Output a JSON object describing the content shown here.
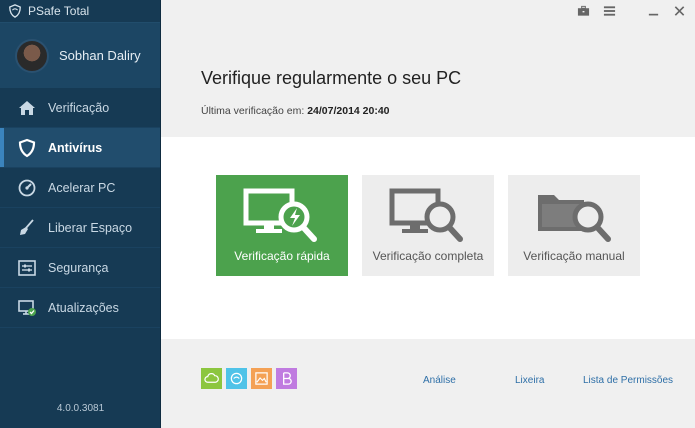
{
  "app": {
    "title": "PSafe Total",
    "version": "4.0.0.3081"
  },
  "user": {
    "name": "Sobhan Daliry"
  },
  "sidebar": {
    "items": [
      {
        "label": "Verificação",
        "icon": "home-icon"
      },
      {
        "label": "Antivírus",
        "icon": "shield-icon"
      },
      {
        "label": "Acelerar PC",
        "icon": "speedometer-icon"
      },
      {
        "label": "Liberar Espaço",
        "icon": "broom-icon"
      },
      {
        "label": "Segurança",
        "icon": "settings-panel-icon"
      },
      {
        "label": "Atualizações",
        "icon": "monitor-check-icon"
      }
    ],
    "active_index": 1
  },
  "main": {
    "heading": "Verifique regularmente o seu PC",
    "last_scan_label": "Última verificação em:",
    "last_scan_value": "24/07/2014 20:40",
    "tiles": [
      {
        "label": "Verificação rápida",
        "icon": "monitor-lightning-magnifier-icon",
        "highlighted": true
      },
      {
        "label": "Verificação completa",
        "icon": "monitor-magnifier-icon",
        "highlighted": false
      },
      {
        "label": "Verificação manual",
        "icon": "folder-magnifier-icon",
        "highlighted": false
      }
    ]
  },
  "footer": {
    "apps": [
      {
        "icon": "cloud-icon",
        "color": "#8cc63f"
      },
      {
        "icon": "circle-arrows-icon",
        "color": "#4fc3e8"
      },
      {
        "icon": "image-icon",
        "color": "#f4a155"
      },
      {
        "icon": "b-letter-icon",
        "color": "#c07be0"
      }
    ],
    "links": {
      "analysis": "Análise",
      "trash": "Lixeira",
      "permissions": "Lista de Permissões"
    }
  },
  "colors": {
    "sidebar": "#163a54",
    "accent_green": "#4ca24d",
    "link": "#2e6fa7"
  }
}
